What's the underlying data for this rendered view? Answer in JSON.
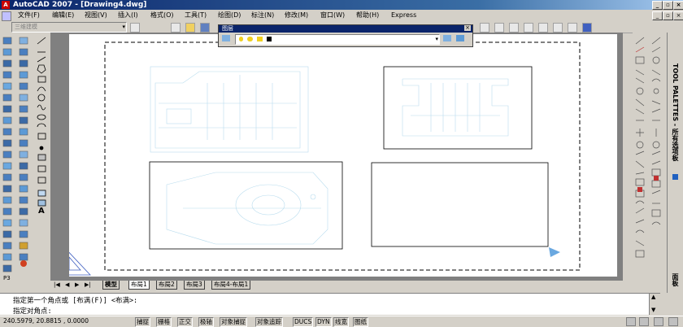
{
  "window": {
    "title": "AutoCAD 2007 - [Drawing4.dwg]"
  },
  "menu": [
    "文件(F)",
    "编辑(E)",
    "视图(V)",
    "插入(I)",
    "格式(O)",
    "工具(T)",
    "绘图(D)",
    "标注(N)",
    "修改(M)",
    "窗口(W)",
    "帮助(H)",
    "Express"
  ],
  "workspace": {
    "combo_label": "三维建模"
  },
  "layer_panel": {
    "title": "图层"
  },
  "tool_palette": {
    "label": "TOOL PALETTES - 所有选项板",
    "bottom_tab": "面板"
  },
  "layout_tabs": [
    "模型",
    "布局1",
    "布局2",
    "布局3",
    "布局4-布局1"
  ],
  "command": {
    "line1": "指定第一个角点或 [布满(F)] <布满>:",
    "line2": "指定对角点:"
  },
  "status": {
    "coords": "240.5979, 20.8815 , 0.0000",
    "toggles": [
      "捕捉",
      "栅格",
      "正交",
      "极轴",
      "对象捕捉",
      "对象追踪",
      "DUCS",
      "DYN",
      "线宽",
      "图纸"
    ]
  }
}
